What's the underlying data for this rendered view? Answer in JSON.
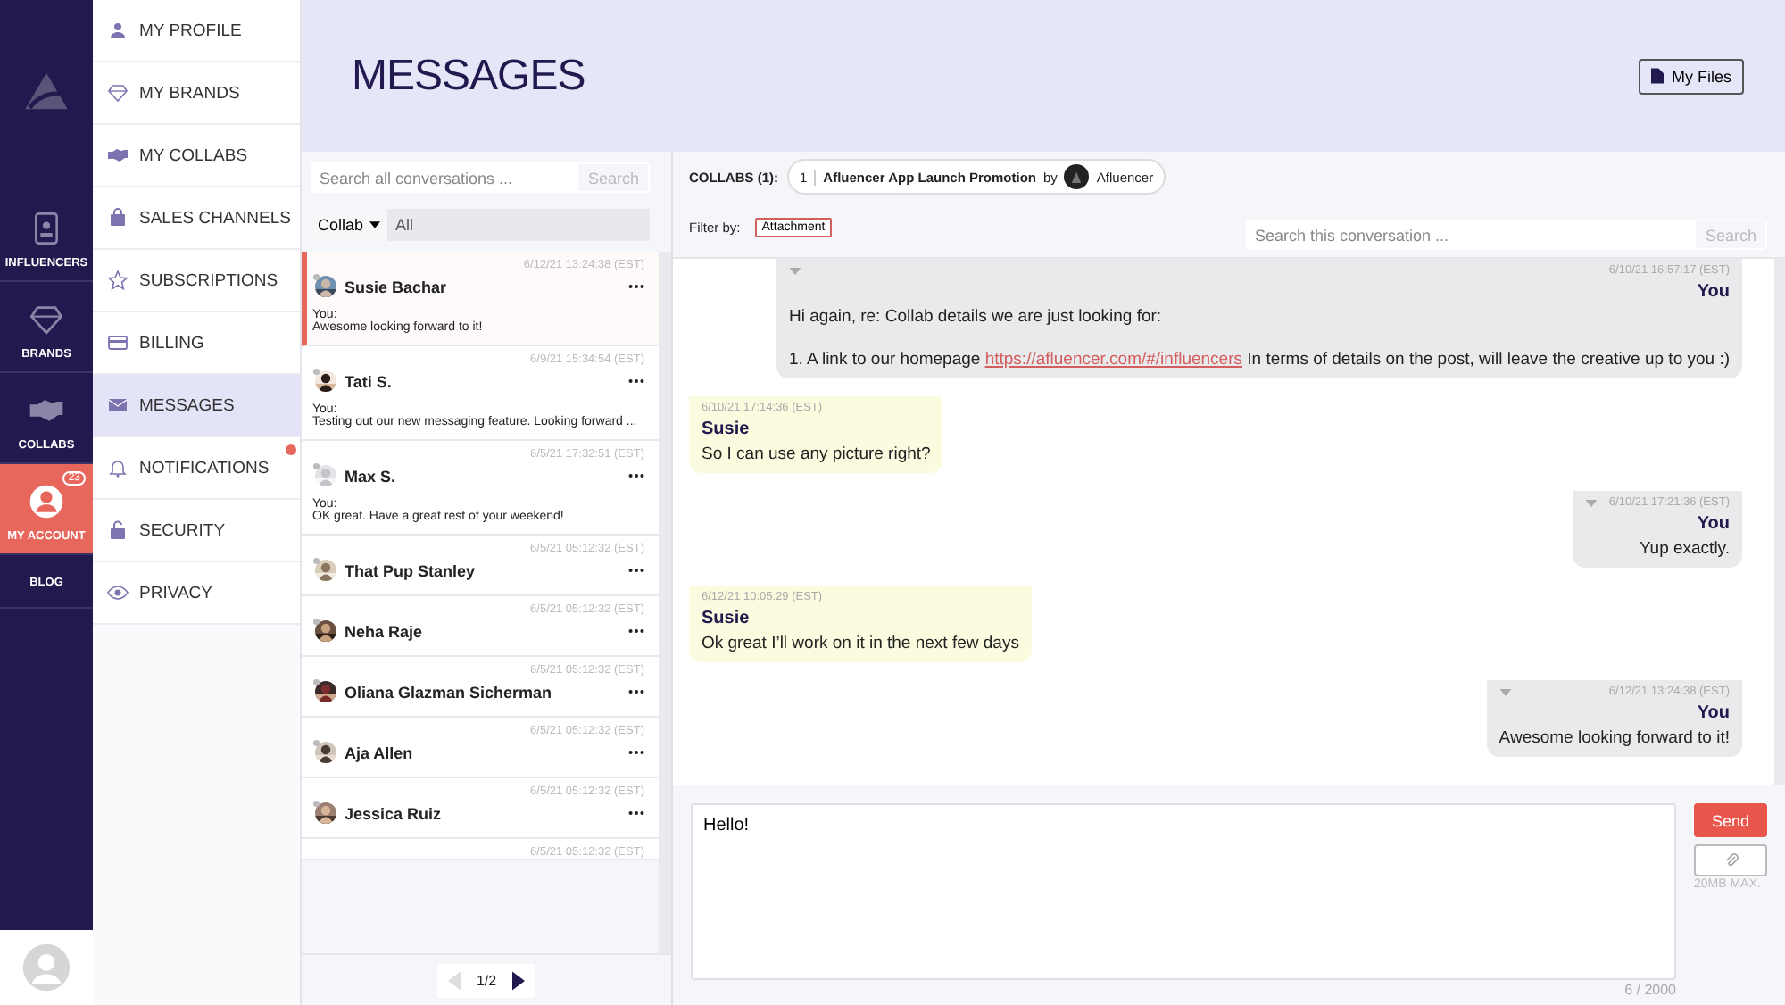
{
  "rail": {
    "items": [
      {
        "label": "INFLUENCERS",
        "selected": false
      },
      {
        "label": "BRANDS",
        "selected": false
      },
      {
        "label": "COLLABS",
        "selected": false
      },
      {
        "label": "MY ACCOUNT",
        "selected": true,
        "badge": "23"
      },
      {
        "label": "BLOG",
        "selected": false
      }
    ]
  },
  "menu": {
    "items": [
      {
        "label": "MY PROFILE",
        "selected": false,
        "dot": false
      },
      {
        "label": "MY BRANDS",
        "selected": false,
        "dot": false
      },
      {
        "label": "MY COLLABS",
        "selected": false,
        "dot": false
      },
      {
        "label": "SALES CHANNELS",
        "selected": false,
        "dot": false
      },
      {
        "label": "SUBSCRIPTIONS",
        "selected": false,
        "dot": false
      },
      {
        "label": "BILLING",
        "selected": false,
        "dot": false
      },
      {
        "label": "MESSAGES",
        "selected": true,
        "dot": false
      },
      {
        "label": "NOTIFICATIONS",
        "selected": false,
        "dot": true
      },
      {
        "label": "SECURITY",
        "selected": false,
        "dot": false
      },
      {
        "label": "PRIVACY",
        "selected": false,
        "dot": false
      }
    ]
  },
  "header": {
    "title": "MESSAGES",
    "files_button": "My Files"
  },
  "conversations": {
    "search": {
      "placeholder": "Search all conversations ...",
      "button": "Search"
    },
    "filter": {
      "dropdown": "Collab",
      "value": "All"
    },
    "items": [
      {
        "time": "6/12/21 13:24:38 (EST)",
        "name": "Susie Bachar",
        "from": "You:",
        "preview": "Awesome looking forward to it!",
        "selected": true
      },
      {
        "time": "6/9/21 15:34:54 (EST)",
        "name": "Tati S.",
        "from": "You:",
        "preview": "Testing out our new messaging feature. Looking forward ...",
        "selected": false
      },
      {
        "time": "6/5/21 17:32:51 (EST)",
        "name": "Max S.",
        "from": "You:",
        "preview": "OK great. Have a great rest of your weekend!",
        "selected": false
      },
      {
        "time": "6/5/21 05:12:32 (EST)",
        "name": "That Pup Stanley",
        "selected": false
      },
      {
        "time": "6/5/21 05:12:32 (EST)",
        "name": "Neha Raje",
        "selected": false
      },
      {
        "time": "6/5/21 05:12:32 (EST)",
        "name": "Oliana Glazman Sicherman",
        "selected": false
      },
      {
        "time": "6/5/21 05:12:32 (EST)",
        "name": "Aja Allen",
        "selected": false
      },
      {
        "time": "6/5/21 05:12:32 (EST)",
        "name": "Jessica Ruiz",
        "selected": false
      },
      {
        "time": "6/5/21 05:12:32 (EST)",
        "selected": false
      }
    ],
    "page": "1/2"
  },
  "chat": {
    "collabs_label": "COLLABS (1):",
    "collab": {
      "index": "1",
      "title": "Afluencer App Launch Promotion",
      "by": "by",
      "brand": "Afluencer"
    },
    "filter_label": "Filter by:",
    "filter_tag": "Attachment",
    "search": {
      "placeholder": "Search this conversation ...",
      "button": "Search"
    },
    "messages": [
      {
        "kind": "out",
        "time": "6/10/21 16:57:17 (EST)",
        "author": "You",
        "paragraphs": [
          [
            {
              "kind": "text",
              "text": "Hi again, re: Collab details we are just looking for:"
            }
          ],
          [
            {
              "kind": "text",
              "text": "1. A link to our homepage "
            },
            {
              "kind": "link",
              "text": "https://afluencer.com/#/influencers"
            },
            {
              "kind": "text",
              "text": " In terms of details on the post, will leave the creative up to you :)"
            }
          ]
        ]
      },
      {
        "kind": "in",
        "time": "6/10/21 17:14:36 (EST)",
        "author": "Susie",
        "paragraphs": [
          [
            {
              "kind": "text",
              "text": "So I can use any picture right?"
            }
          ]
        ]
      },
      {
        "kind": "out",
        "time": "6/10/21 17:21:36 (EST)",
        "author": "You",
        "paragraphs": [
          [
            {
              "kind": "text",
              "text": "Yup exactly."
            }
          ]
        ]
      },
      {
        "kind": "in",
        "time": "6/12/21 10:05:29 (EST)",
        "author": "Susie",
        "paragraphs": [
          [
            {
              "kind": "text",
              "text": "Ok great I’ll work on it in the next few days"
            }
          ]
        ]
      },
      {
        "kind": "out",
        "time": "6/12/21 13:24:38 (EST)",
        "author": "You",
        "paragraphs": [
          [
            {
              "kind": "text",
              "text": "Awesome looking forward to it!"
            }
          ]
        ]
      }
    ],
    "composer": {
      "value": "Hello!",
      "send": "Send",
      "limit": "20MB MAX.",
      "counter": "6 / 2000"
    }
  }
}
